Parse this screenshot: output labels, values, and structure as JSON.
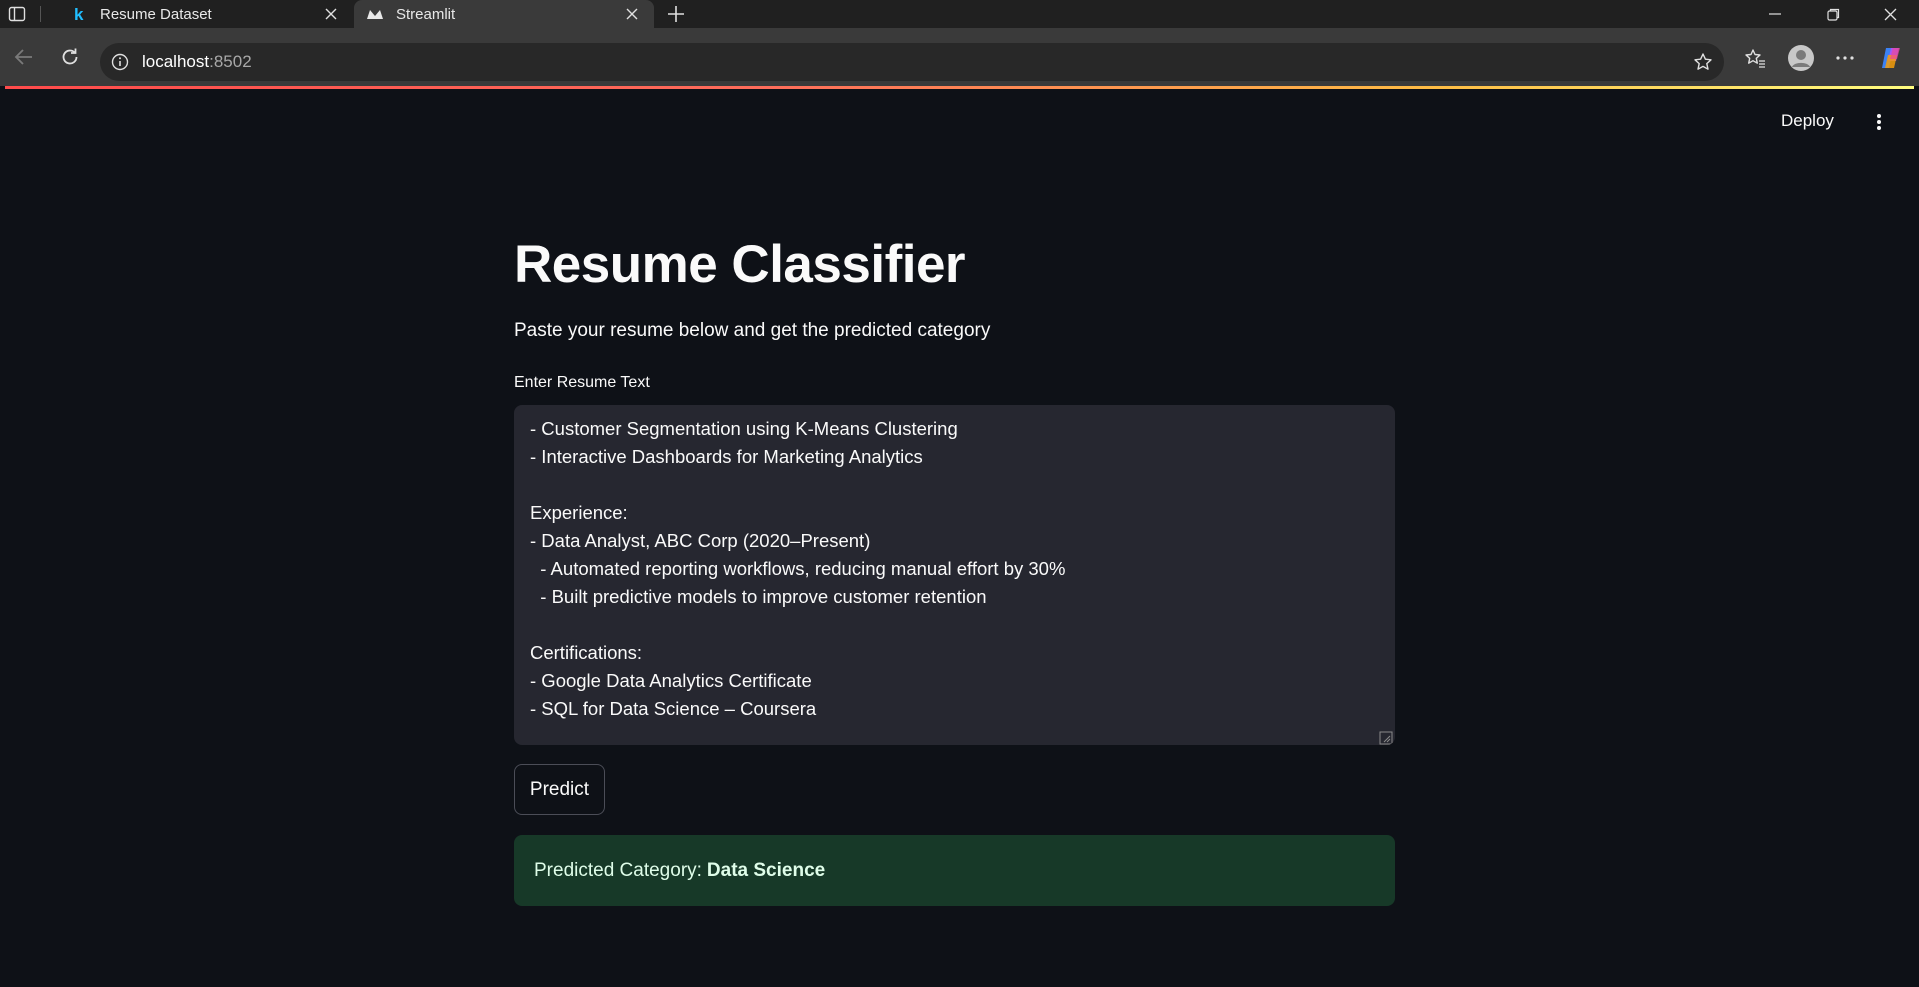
{
  "browser": {
    "tabs": [
      {
        "title": "Resume Dataset",
        "favicon": "kaggle-k-icon",
        "active": false
      },
      {
        "title": "Streamlit",
        "favicon": "streamlit-crown-icon",
        "active": true
      }
    ],
    "address": {
      "host": "localhost",
      "port": ":8502"
    }
  },
  "header": {
    "deploy_label": "Deploy"
  },
  "app": {
    "title": "Resume Classifier",
    "subtitle": "Paste your resume below and get the predicted category",
    "input_label": "Enter Resume Text",
    "resume_lines": [
      "- Customer Segmentation using K-Means Clustering",
      "- Interactive Dashboards for Marketing Analytics",
      "",
      "Experience:",
      "- Data Analyst, ABC Corp (2020–Present)",
      "  - Automated reporting workflows, reducing manual effort by 30%",
      "  - Built predictive models to improve customer retention",
      "",
      "Certifications:",
      "- Google Data Analytics Certificate",
      "- SQL for Data Science – Coursera"
    ],
    "button_label": "Predict",
    "result_prefix": "Predicted Category:",
    "result_value": "Data Science"
  },
  "colors": {
    "background": "#0e1117",
    "textarea_bg": "#262730",
    "success_bg": "#173928",
    "accent_red": "#ff4b4b"
  }
}
